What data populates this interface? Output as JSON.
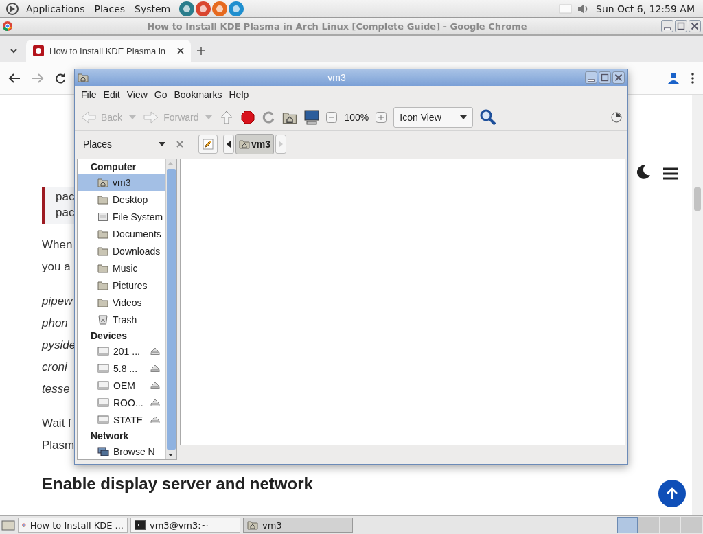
{
  "top_panel": {
    "menus": [
      "Applications",
      "Places",
      "System"
    ],
    "clock": "Sun Oct  6, 12:59 AM"
  },
  "browser": {
    "title": "How to Install KDE Plasma in Arch Linux [Complete Guide] - Google Chrome",
    "tabs": [
      {
        "label": "How to Install KDE Plasma in",
        "selected": true
      }
    ],
    "page": {
      "callout_lines": [
        "pac",
        "pac"
      ],
      "paragraphs": [
        {
          "kind": "plain",
          "lines": [
            "When",
            "you a"
          ]
        },
        {
          "kind": "italic",
          "lines": [
            "pipew",
            "phon",
            "pyside",
            "croni",
            "tesse"
          ]
        },
        {
          "kind": "plain",
          "lines": [
            "Wait f",
            "Plasm"
          ]
        }
      ],
      "heading": "Enable display server and network"
    }
  },
  "file_manager": {
    "title": "vm3",
    "menus": [
      "File",
      "Edit",
      "View",
      "Go",
      "Bookmarks",
      "Help"
    ],
    "toolbar": {
      "back": {
        "label": "Back",
        "disabled": true
      },
      "forward": {
        "label": "Forward",
        "disabled": true
      },
      "zoom": "100%",
      "view": "Icon View"
    },
    "sidebar": {
      "label": "Places",
      "sections": [
        {
          "title": "Computer",
          "items": [
            {
              "label": "vm3",
              "kind": "home",
              "selected": true
            },
            {
              "label": "Desktop",
              "kind": "folder",
              "selected": false
            },
            {
              "label": "File System",
              "kind": "filesystem",
              "selected": false
            },
            {
              "label": "Documents",
              "kind": "folder",
              "selected": false
            },
            {
              "label": "Downloads",
              "kind": "folder",
              "selected": false
            },
            {
              "label": "Music",
              "kind": "folder",
              "selected": false
            },
            {
              "label": "Pictures",
              "kind": "folder",
              "selected": false
            },
            {
              "label": "Videos",
              "kind": "folder",
              "selected": false
            },
            {
              "label": "Trash",
              "kind": "trash",
              "selected": false
            }
          ]
        },
        {
          "title": "Devices",
          "items": [
            {
              "label": "201 ...",
              "kind": "drive",
              "selected": false
            },
            {
              "label": "5.8 ...",
              "kind": "drive",
              "selected": false
            },
            {
              "label": "OEM",
              "kind": "drive",
              "selected": false
            },
            {
              "label": "ROO...",
              "kind": "drive",
              "selected": false
            },
            {
              "label": "STATE",
              "kind": "drive",
              "selected": false
            }
          ]
        },
        {
          "title": "Network",
          "items": [
            {
              "label": "Browse N",
              "kind": "network",
              "selected": false
            }
          ]
        }
      ]
    },
    "path": [
      {
        "label": "vm3",
        "selected": true
      }
    ]
  },
  "taskbar": {
    "items": [
      {
        "label": "How to Install KDE ...",
        "kind": "browser",
        "selected": false
      },
      {
        "label": "vm3@vm3:~",
        "kind": "terminal",
        "selected": false
      },
      {
        "label": "vm3",
        "kind": "folder",
        "selected": true
      }
    ],
    "workspaces": [
      {
        "selected": true
      },
      {
        "selected": false
      },
      {
        "selected": false
      },
      {
        "selected": false
      }
    ]
  }
}
